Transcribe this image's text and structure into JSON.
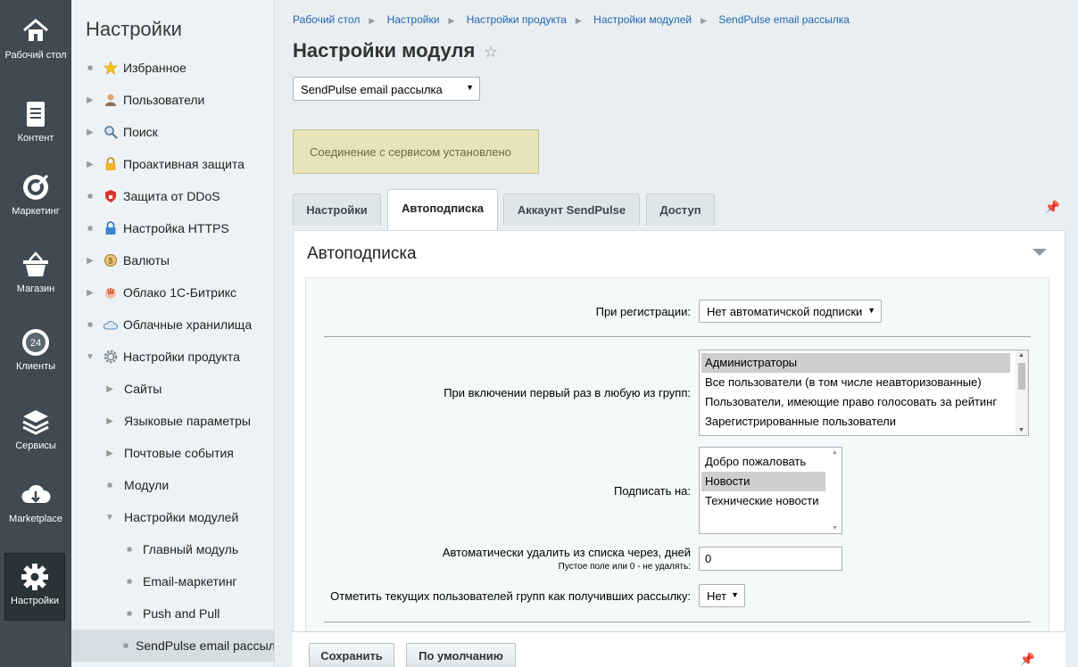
{
  "rail": {
    "items": [
      {
        "label": "Рабочий стол",
        "icon": "home-icon"
      },
      {
        "label": "Контент",
        "icon": "document-icon"
      },
      {
        "label": "Маркетинг",
        "icon": "target-icon"
      },
      {
        "label": "Магазин",
        "icon": "basket-icon"
      },
      {
        "label": "Клиенты",
        "icon": "clock-24-icon"
      },
      {
        "label": "Сервисы",
        "icon": "layers-icon"
      },
      {
        "label": "Marketplace",
        "icon": "cloud-download-icon"
      },
      {
        "label": "Настройки",
        "icon": "gear-icon"
      }
    ]
  },
  "menu": {
    "title": "Настройки",
    "items": [
      {
        "label": "Избранное",
        "icon": "star-icon",
        "marker": "■"
      },
      {
        "label": "Пользователи",
        "icon": "user-icon",
        "marker": "▶"
      },
      {
        "label": "Поиск",
        "icon": "magnifier-icon",
        "marker": "▶"
      },
      {
        "label": "Проактивная защита",
        "icon": "lock-icon",
        "marker": "▶"
      },
      {
        "label": "Защита от DDoS",
        "icon": "shield-icon",
        "marker": "■"
      },
      {
        "label": "Настройка HTTPS",
        "icon": "https-lock-icon",
        "marker": "■"
      },
      {
        "label": "Валюты",
        "icon": "currency-icon",
        "marker": "▶"
      },
      {
        "label": "Облако 1С-Битрикс",
        "icon": "cloud-bitrix-icon",
        "marker": "▶"
      },
      {
        "label": "Облачные хранилища",
        "icon": "cloud-storage-icon",
        "marker": "■"
      },
      {
        "label": "Настройки продукта",
        "icon": "gear-icon",
        "marker": "▼"
      },
      {
        "label": "Сайты",
        "marker": "▶"
      },
      {
        "label": "Языковые параметры",
        "marker": "▶"
      },
      {
        "label": "Почтовые события",
        "marker": "▶"
      },
      {
        "label": "Модули",
        "marker": "■"
      },
      {
        "label": "Настройки модулей",
        "marker": "▼"
      },
      {
        "label": "Главный модуль",
        "marker": "■"
      },
      {
        "label": "Email-маркетинг",
        "marker": "■"
      },
      {
        "label": "Push and Pull",
        "marker": "■"
      },
      {
        "label": "SendPulse email рассыл",
        "marker": "■"
      }
    ]
  },
  "breadcrumbs": [
    "Рабочий стол",
    "Настройки",
    "Настройки продукта",
    "Настройки модулей",
    "SendPulse email рассылка"
  ],
  "page": {
    "title": "Настройки модуля",
    "star_icon": "star-outline-icon",
    "module_select": "SendPulse email рассылка",
    "notice": "Соединение с сервисом установлено"
  },
  "tabs": [
    "Настройки",
    "Автоподписка",
    "Аккаунт SendPulse",
    "Доступ"
  ],
  "panel": {
    "title": "Автоподписка",
    "registration_label": "При регистрации:",
    "registration_value": "Нет автоматичской подписки",
    "groups_label": "При включении первый раз в любую из групп:",
    "groups_options": [
      "Администраторы",
      "Все пользователи (в том числе неавторизованные)",
      "Пользователи, имеющие право голосовать за рейтинг",
      "Зарегистрированные пользователи"
    ],
    "subscribe_label": "Подписать на:",
    "subscribe_options": [
      "Добро пожаловать",
      "Новости",
      "Технические новости"
    ],
    "autodelete_label": "Автоматически удалить из списка через, дней",
    "autodelete_hint": "Пустое поле или 0 - не удалять:",
    "autodelete_value": "0",
    "mark_label": "Отметить текущих пользователей групп как получивших рассылку:",
    "mark_value": "Нет"
  },
  "footer": {
    "save": "Сохранить",
    "default": "По умолчанию"
  }
}
